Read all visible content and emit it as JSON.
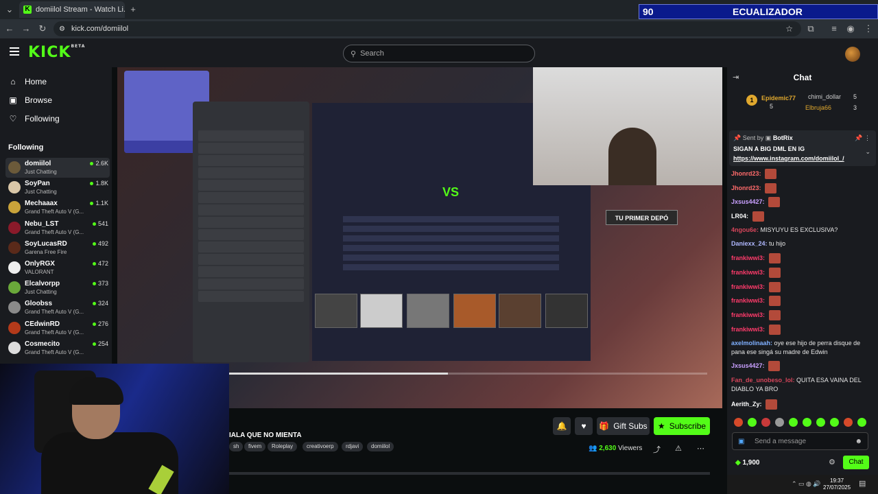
{
  "browser": {
    "tab_title": "domiilol Stream - Watch Li...",
    "url": "kick.com/domiilol"
  },
  "overlay": {
    "eq_value": "90",
    "eq_label": "ECUALIZADOR"
  },
  "header": {
    "logo": "KICK",
    "logo_badge": "BETA",
    "search_placeholder": "Search"
  },
  "sidebar": {
    "nav": [
      {
        "label": "Home",
        "icon": "home-icon"
      },
      {
        "label": "Browse",
        "icon": "compass-icon"
      },
      {
        "label": "Following",
        "icon": "heart-icon"
      }
    ],
    "following_title": "Following",
    "channels": [
      {
        "name": "domiilol",
        "category": "Just Chatting",
        "viewers": "2.6K",
        "color": "#6b5a3a"
      },
      {
        "name": "SoyPan",
        "category": "Just Chatting",
        "viewers": "1.8K",
        "color": "#d9c7a8"
      },
      {
        "name": "Mechaaax",
        "category": "Grand Theft Auto V (G...",
        "viewers": "1.1K",
        "color": "#c9a33a"
      },
      {
        "name": "Nebu_LST",
        "category": "Grand Theft Auto V (G...",
        "viewers": "541",
        "color": "#8a1a2a"
      },
      {
        "name": "SoyLucasRD",
        "category": "Garena Free Fire",
        "viewers": "492",
        "color": "#5a2a1a"
      },
      {
        "name": "OnlyRGX",
        "category": "VALORANT",
        "viewers": "472",
        "color": "#eeeeee"
      },
      {
        "name": "Elcalvorpp",
        "category": "Just Chatting",
        "viewers": "373",
        "color": "#6aa83a"
      },
      {
        "name": "Gloobss",
        "category": "Grand Theft Auto V (G...",
        "viewers": "324",
        "color": "#8a8a8a"
      },
      {
        "name": "CEdwinRD",
        "category": "Grand Theft Auto V (G...",
        "viewers": "276",
        "color": "#b33a1a"
      },
      {
        "name": "Cosmecito",
        "category": "Grand Theft Auto V (G...",
        "viewers": "254",
        "color": "#dddddd"
      }
    ]
  },
  "video": {
    "promo_text": "TU PRIMER DEPÓ",
    "vs_text": "VS",
    "progress": 0.46
  },
  "stream": {
    "title": "IALA QUE NO MIENTA",
    "tags": [
      "sh",
      "fivem",
      "Roleplay",
      "creativoerp",
      "rdjavi",
      "domiilol"
    ],
    "gift_label": "Gift Subs",
    "subscribe_label": "Subscribe",
    "viewer_count": "2,630",
    "viewer_label": "Viewers"
  },
  "chat": {
    "title": "Chat",
    "leaderboard": [
      {
        "rank": "1",
        "name": "Epidemic77",
        "count": "5"
      },
      {
        "rank": "",
        "name": "chimi_dollar",
        "count": "5"
      },
      {
        "rank": "",
        "name": "Elbruja66",
        "count": "3"
      }
    ],
    "pinned_sent_by": "Sent by",
    "pinned_bot": "BotRix",
    "pinned_message": "SIGAN A BIG DML EN IG",
    "pinned_link": "https://www.instagram.com/domiilol_/",
    "messages": [
      {
        "user": "Jhonrd23:",
        "text": "",
        "emote": true,
        "color": "#ff6b6b"
      },
      {
        "user": "Jhonrd23:",
        "text": "",
        "emote": true,
        "color": "#ff6b6b"
      },
      {
        "user": "Jxsus4427:",
        "text": "",
        "emote": true,
        "color": "#c9a0ff"
      },
      {
        "user": "LR04:",
        "text": "",
        "emote": true,
        "color": "#ffffff"
      },
      {
        "user": "4ngou6e:",
        "text": "MISYUYU ES EXCLUSIVA?",
        "emote": false,
        "color": "#d6455a"
      },
      {
        "user": "Daniexx_24:",
        "text": "tu hijo",
        "emote": false,
        "color": "#b0b8ff"
      },
      {
        "user": "frankiwwi3:",
        "text": "",
        "emote": true,
        "color": "#ff3b6b"
      },
      {
        "user": "frankiwwi3:",
        "text": "",
        "emote": true,
        "color": "#ff3b6b"
      },
      {
        "user": "frankiwwi3:",
        "text": "",
        "emote": true,
        "color": "#ff3b6b"
      },
      {
        "user": "frankiwwi3:",
        "text": "",
        "emote": true,
        "color": "#ff3b6b"
      },
      {
        "user": "frankiwwi3:",
        "text": "",
        "emote": true,
        "color": "#ff3b6b"
      },
      {
        "user": "frankiwwi3:",
        "text": "",
        "emote": true,
        "color": "#ff3b6b"
      },
      {
        "user": "axelmolinaah:",
        "text": "oye ese hijo de perra disque de pana ese singá su madre de Edwin",
        "emote": false,
        "color": "#7fb0ff"
      },
      {
        "user": "Jxsus4427:",
        "text": "",
        "emote": true,
        "color": "#c9a0ff"
      },
      {
        "user": "Fan_de_unobeso_lol:",
        "text": "QUITA ESA VAINA DEL DIABLO YA BRO",
        "emote": false,
        "color": "#d6455a"
      },
      {
        "user": "Aerith_Zy:",
        "text": "",
        "emote": true,
        "color": "#ffffff"
      }
    ],
    "input_placeholder": "Send a message",
    "points": "1,900",
    "chat_button": "Chat"
  },
  "taskbar": {
    "time": "19:37",
    "date": "27/07/2025"
  }
}
